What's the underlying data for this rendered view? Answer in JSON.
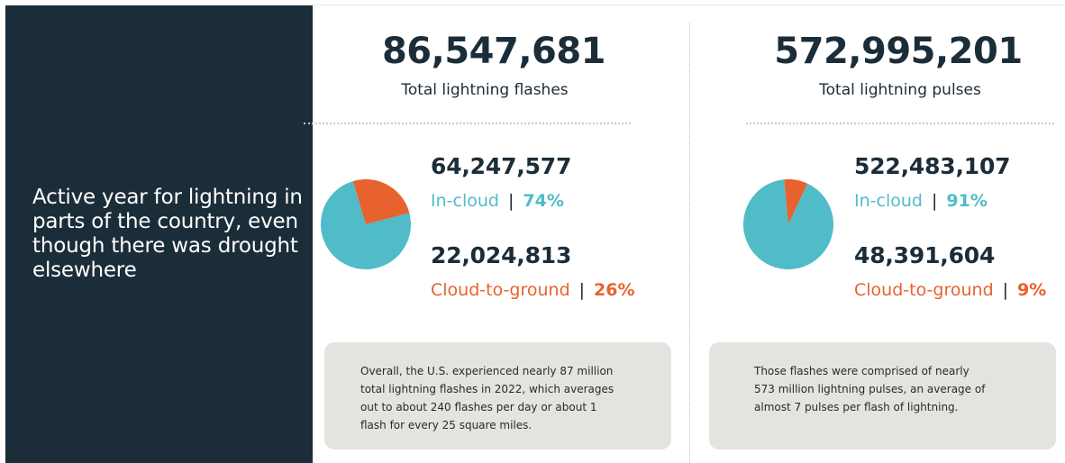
{
  "headline": "Active year for lightning in parts of the country, even though there was drought elsewhere",
  "colors": {
    "dark": "#1b2d38",
    "in_cloud": "#4fbcc8",
    "cloud_to_ground": "#e8622e",
    "note_bg": "#e4e3df"
  },
  "flashes": {
    "total": "86,547,681",
    "total_label": "Total lightning flashes",
    "in_cloud_value": "64,247,577",
    "in_cloud_label": "In-cloud",
    "in_cloud_pct": "74%",
    "ground_value": "22,024,813",
    "ground_label": "Cloud-to-ground",
    "ground_pct": "26%",
    "separator": "|",
    "note": "Overall, the U.S. experienced nearly 87 million total lightning flashes in 2022, which averages out to about 240 flashes per day or about 1 flash for every 25 square miles."
  },
  "pulses": {
    "total": "572,995,201",
    "total_label": "Total lightning pulses",
    "in_cloud_value": "522,483,107",
    "in_cloud_label": "In-cloud",
    "in_cloud_pct": "91%",
    "ground_value": "48,391,604",
    "ground_label": "Cloud-to-ground",
    "ground_pct": "9%",
    "separator": "|",
    "note": "Those flashes were comprised of nearly 573 million lightning pulses, an average of almost 7 pulses per flash of lightning."
  },
  "chart_data": [
    {
      "type": "pie",
      "categories": [
        "In-cloud",
        "Cloud-to-ground"
      ],
      "values": [
        64247577,
        22024813
      ],
      "percent": [
        74,
        26
      ],
      "colors": [
        "#4fbcc8",
        "#e8622e"
      ]
    },
    {
      "type": "pie",
      "categories": [
        "In-cloud",
        "Cloud-to-ground"
      ],
      "values": [
        522483107,
        48391604
      ],
      "percent": [
        91,
        9
      ],
      "colors": [
        "#4fbcc8",
        "#e8622e"
      ]
    }
  ]
}
